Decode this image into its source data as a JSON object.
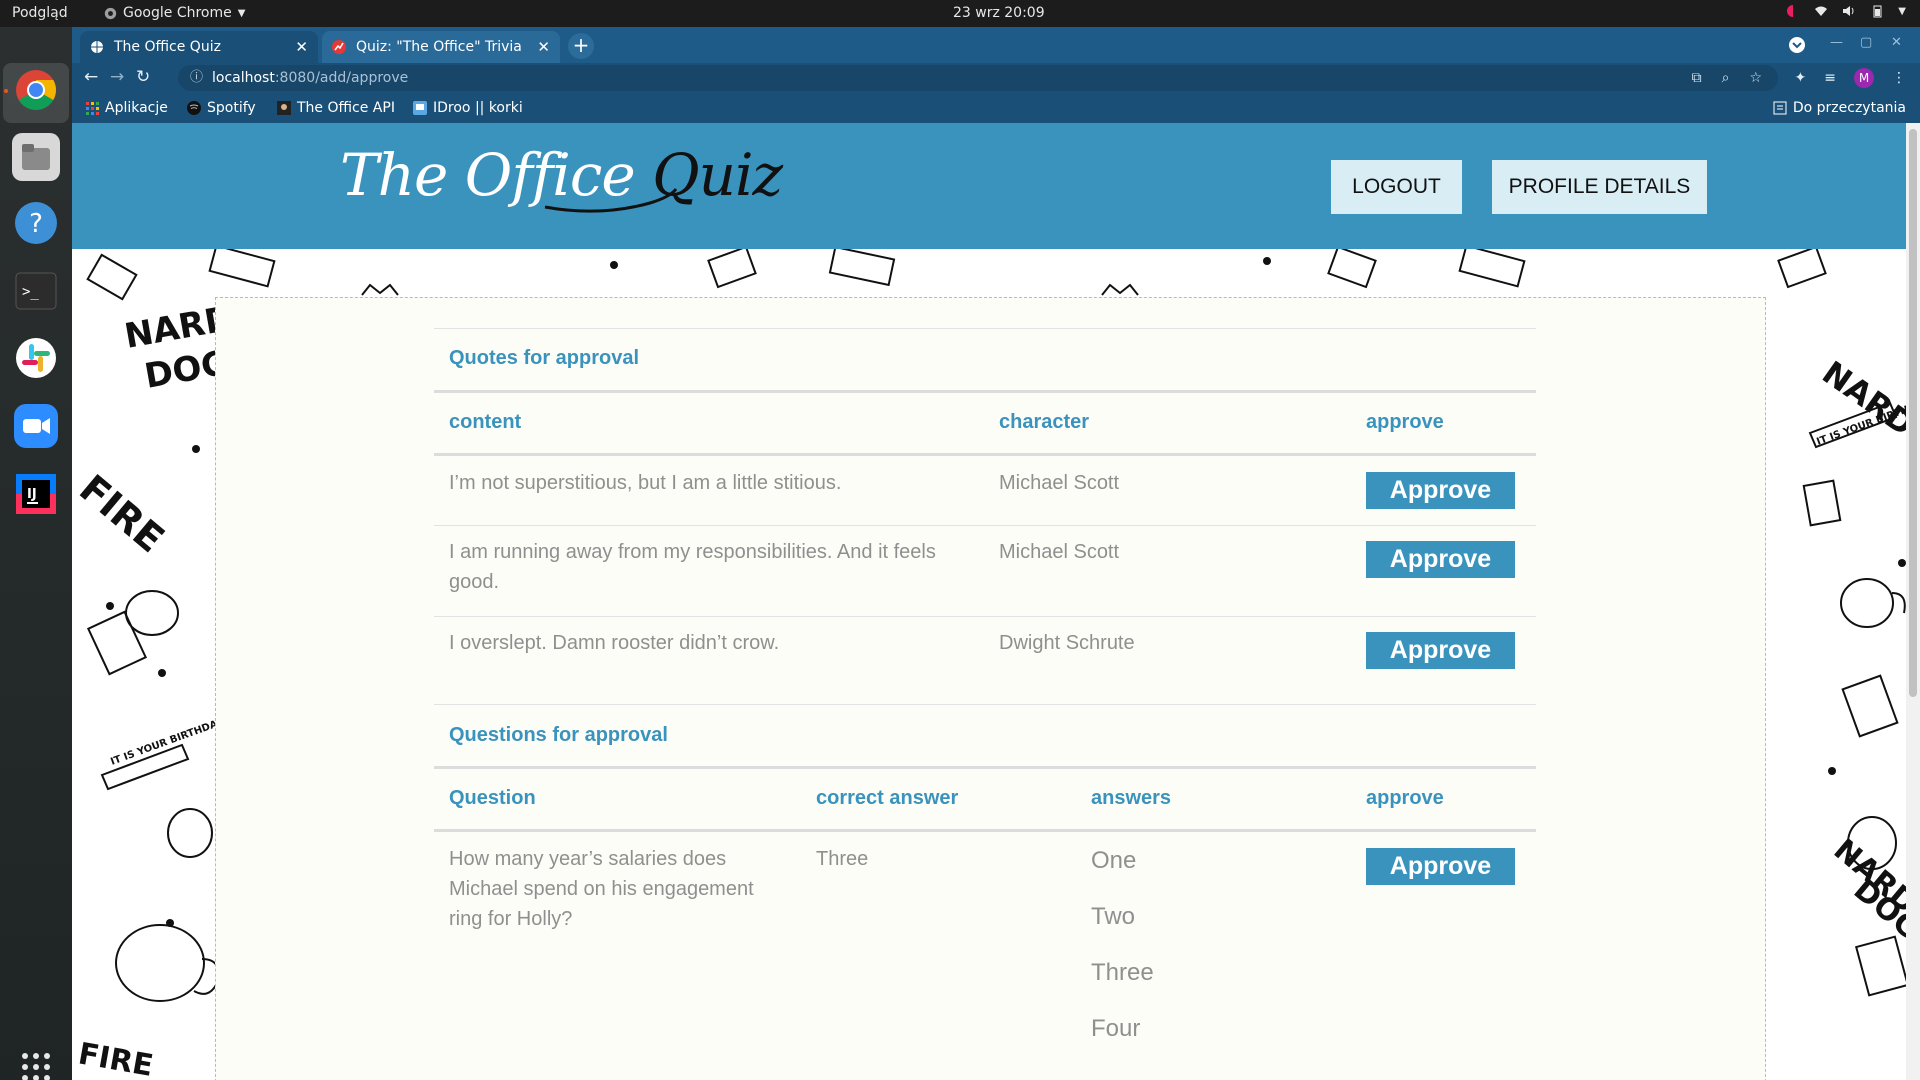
{
  "os": {
    "activities": "Podgląd",
    "app_menu": "Google Chrome",
    "clock": "23 wrz  20:09"
  },
  "browser": {
    "tabs": [
      {
        "title": "The Office Quiz"
      },
      {
        "title": "Quiz: \"The Office\" Trivia C"
      }
    ],
    "url_host": "localhost",
    "url_path": ":8080/add/approve",
    "profile_initial": "M",
    "bookmarks": [
      "Aplikacje",
      "Spotify",
      "The Office API",
      "IDroo || korki"
    ],
    "reading_list": "Do przeczytania"
  },
  "site": {
    "logo_main": "The Office",
    "logo_accent": "Quiz",
    "logout": "LOGOUT",
    "profile_details": "PROFILE DETAILS"
  },
  "quotes": {
    "title": "Quotes for approval",
    "headers": {
      "content": "content",
      "character": "character",
      "approve": "approve"
    },
    "rows": [
      {
        "content": "I’m not superstitious, but I am a little stitious.",
        "character": "Michael Scott",
        "action": "Approve"
      },
      {
        "content": "I am running away from my responsibilities. And it feels good.",
        "character": "Michael Scott",
        "action": "Approve"
      },
      {
        "content": "I overslept. Damn rooster didn’t crow.",
        "character": "Dwight Schrute",
        "action": "Approve"
      }
    ]
  },
  "questions": {
    "title": "Questions for approval",
    "headers": {
      "question": "Question",
      "correct": "correct answer",
      "answers": "answers",
      "approve": "approve"
    },
    "rows": [
      {
        "question": "How many year’s salaries does Michael spend on his engagement ring for Holly?",
        "correct": "Three",
        "answers": [
          "One",
          "Two",
          "Three",
          "Four"
        ],
        "action": "Approve"
      }
    ]
  }
}
